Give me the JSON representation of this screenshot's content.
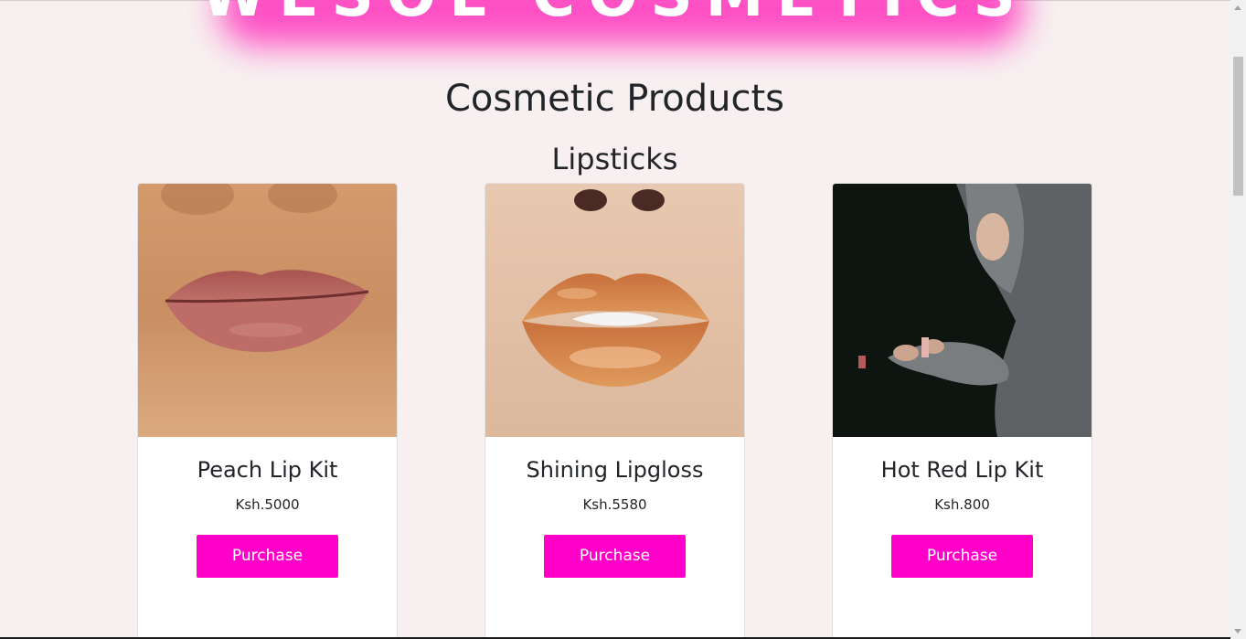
{
  "brand": {
    "title": "WESOL COSMETICS"
  },
  "page": {
    "title": "Cosmetic Products"
  },
  "section": {
    "title": "Lipsticks"
  },
  "products": [
    {
      "name": "Peach Lip Kit",
      "price": "Ksh.5000",
      "button": "Purchase",
      "image": "peach-lips-photo"
    },
    {
      "name": "Shining Lipgloss",
      "price": "Ksh.5580",
      "button": "Purchase",
      "image": "glossy-lips-photo"
    },
    {
      "name": "Hot Red Lip Kit",
      "price": "Ksh.800",
      "button": "Purchase",
      "image": "woman-applying-lipgloss-photo"
    }
  ],
  "colors": {
    "accent": "#ff00c8",
    "background": "#f7eff0",
    "brand_glow": "#ff3ec0"
  }
}
